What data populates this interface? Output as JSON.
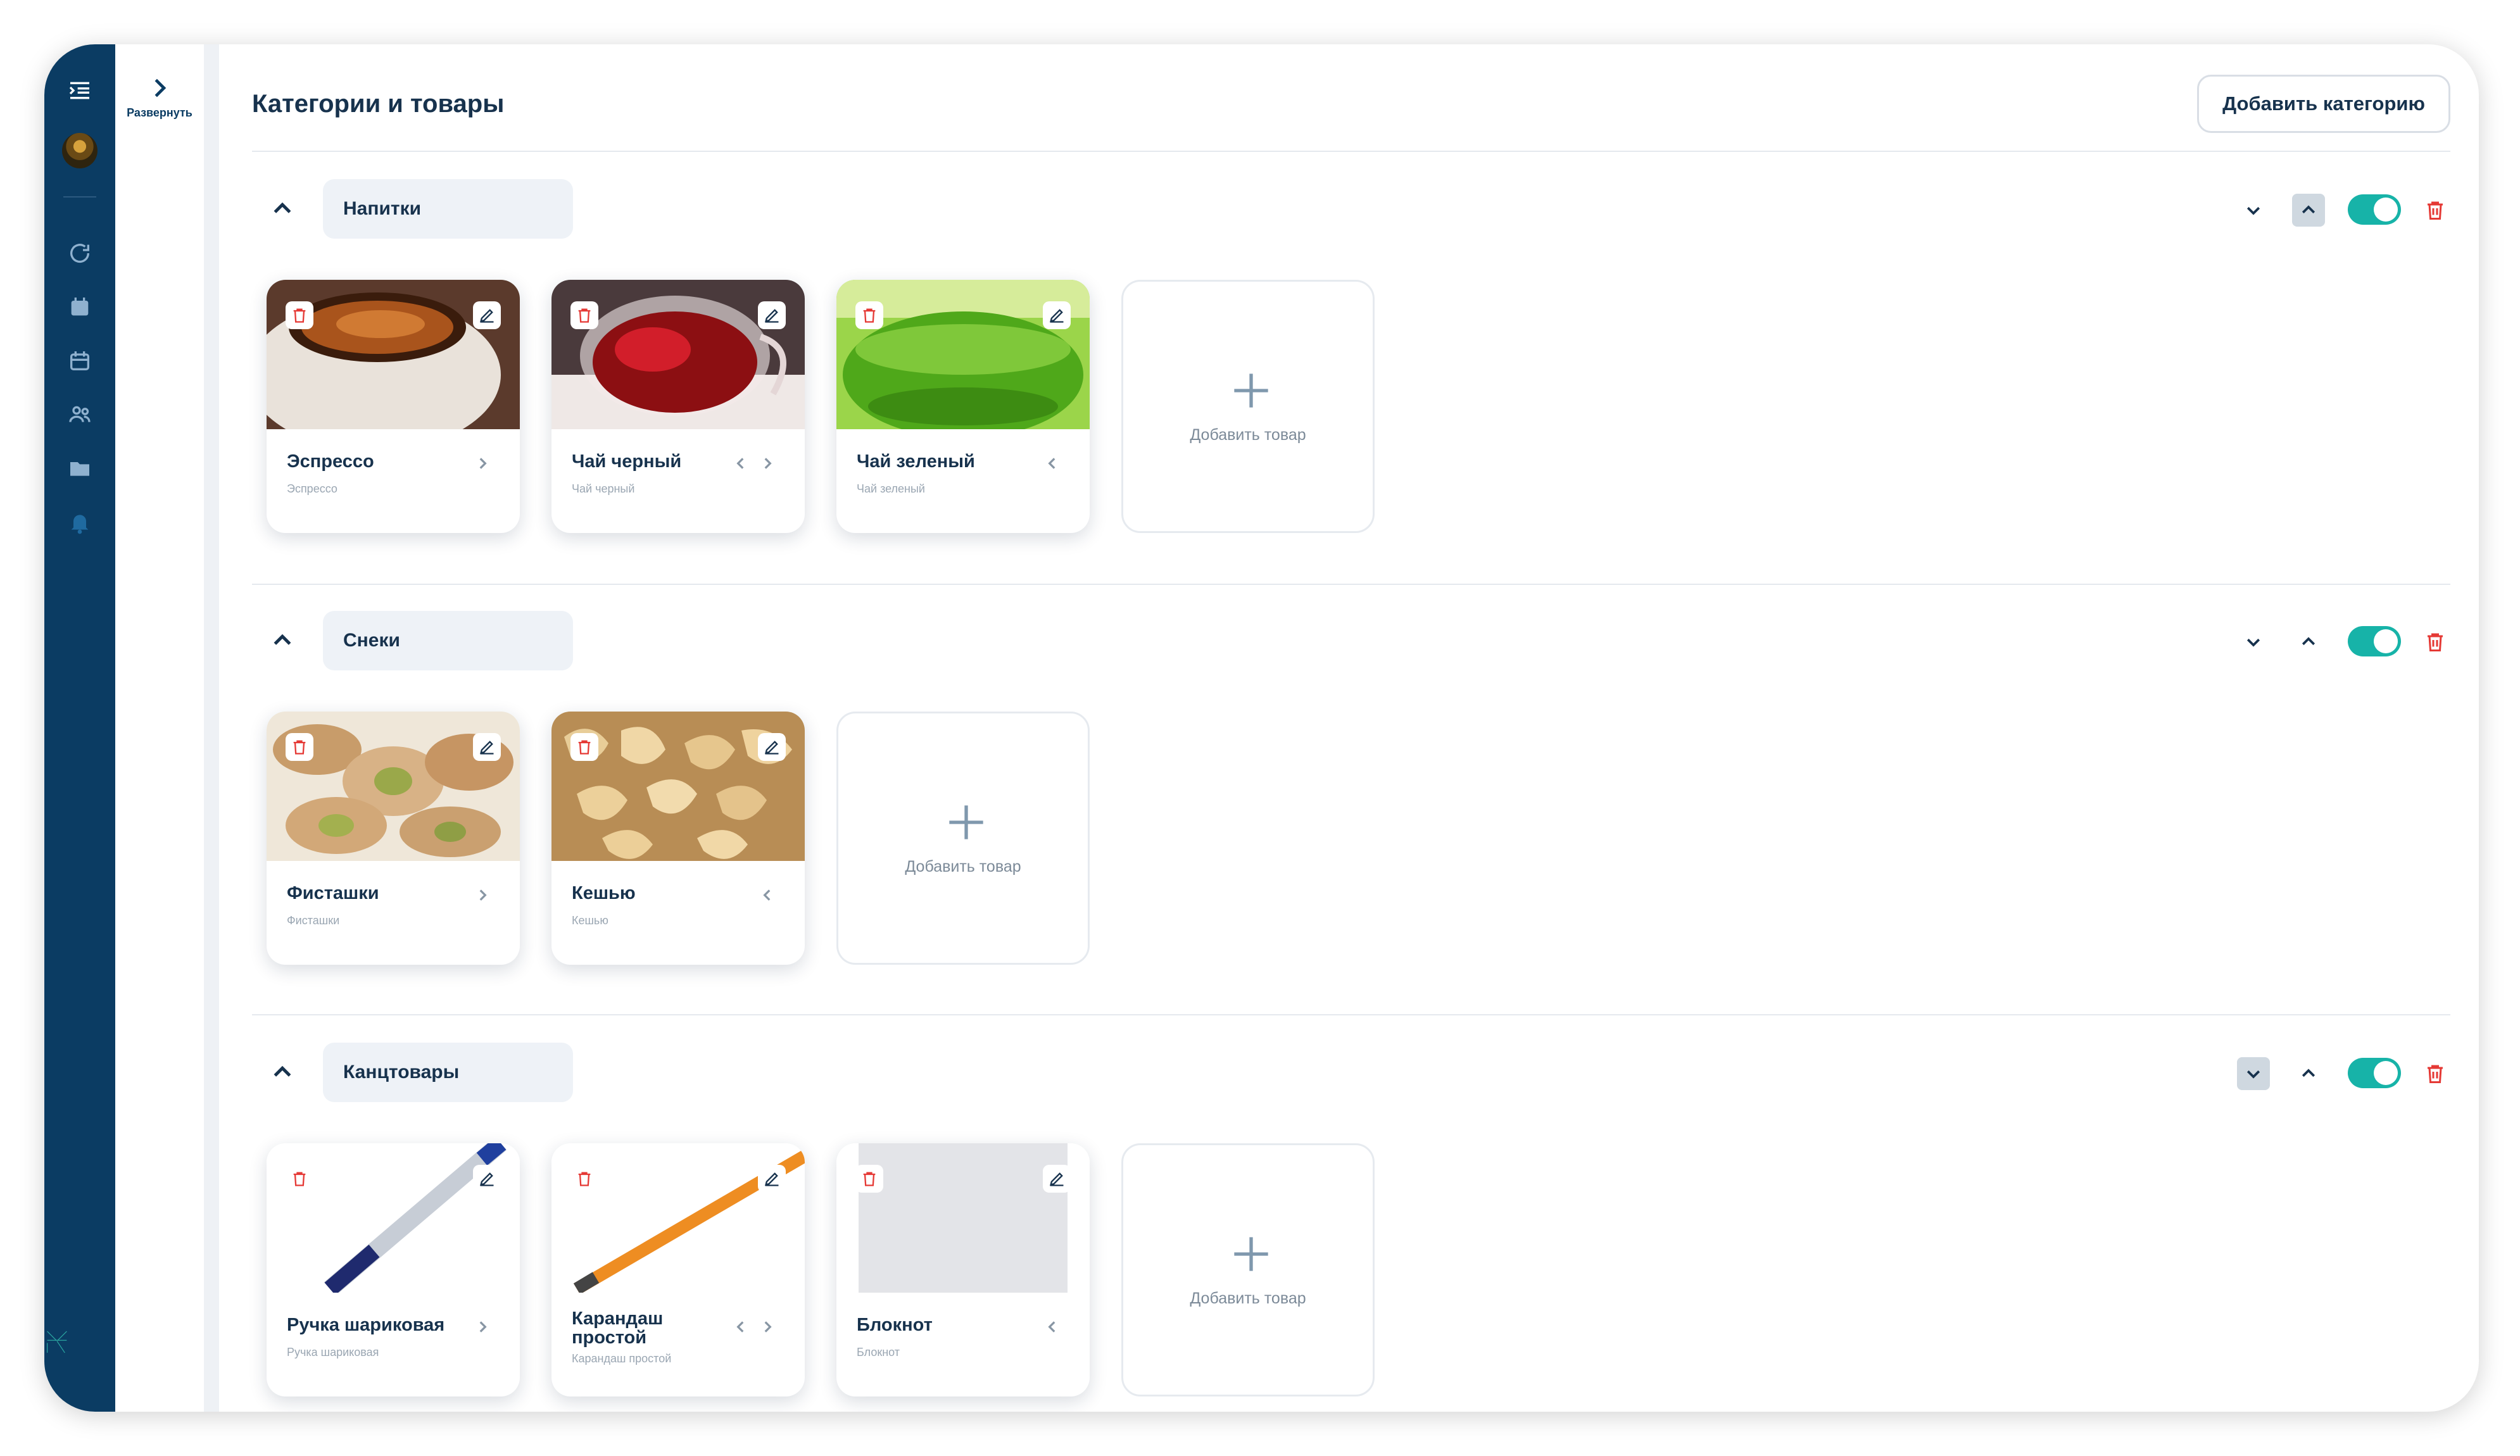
{
  "expand_label": "Развернуть",
  "page_title": "Категории и товары",
  "add_category_label": "Добавить категорию",
  "add_product_label": "Добавить товар",
  "categories": [
    {
      "name": "Напитки",
      "enabled": true,
      "products": [
        {
          "title": "Эспрессо",
          "subtitle": "Эспрессо"
        },
        {
          "title": "Чай черный",
          "subtitle": "Чай черный"
        },
        {
          "title": "Чай зеленый",
          "subtitle": "Чай зеленый"
        }
      ]
    },
    {
      "name": "Снеки",
      "enabled": true,
      "products": [
        {
          "title": "Фисташки",
          "subtitle": "Фисташки"
        },
        {
          "title": "Кешью",
          "subtitle": "Кешью"
        }
      ]
    },
    {
      "name": "Канцтовары",
      "enabled": true,
      "products": [
        {
          "title": "Ручка шариковая",
          "subtitle": "Ручка шариковая"
        },
        {
          "title": "Карандаш простой",
          "subtitle": "Карандаш простой"
        },
        {
          "title": "Блокнот",
          "subtitle": "Блокнот"
        }
      ]
    }
  ],
  "colors": {
    "sidebar": "#0b3c63",
    "toggle_on": "#17b3a8",
    "delete": "#e53935"
  }
}
